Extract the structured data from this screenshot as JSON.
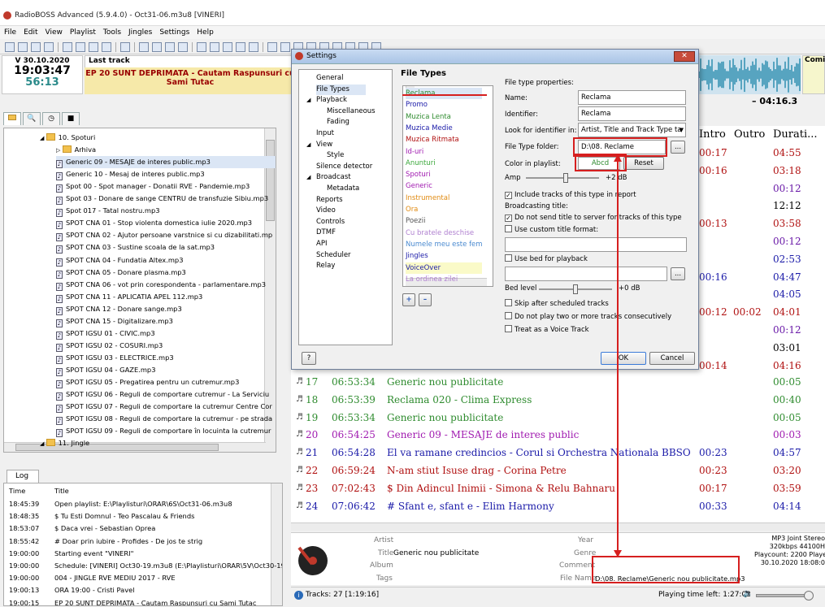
{
  "window": {
    "title": "RadioBOSS Advanced (5.9.4.0) - Oct31-06.m3u8 [VINERI]"
  },
  "menu": [
    "File",
    "Edit",
    "View",
    "Playlist",
    "Tools",
    "Jingles",
    "Settings",
    "Help"
  ],
  "header": {
    "date": "V 30.10.2020",
    "time": "19:03:47",
    "seconds": "56:13",
    "last_track_label": "Last track",
    "now_playing_line1": "EP 20 SUNT DEPRIMATA - Cautam Raspunsuri cu",
    "now_playing_line2": "Sami Tutac",
    "remaining": "– 04:16.3",
    "coming_label": "Comin"
  },
  "left_tabs": [
    "folder",
    "search",
    "clock",
    "db"
  ],
  "tree": [
    {
      "indent": 0,
      "type": "folder",
      "label": "10. Spoturi"
    },
    {
      "indent": 1,
      "type": "folder",
      "label": "Arhiva"
    },
    {
      "indent": 1,
      "type": "file",
      "label": "Generic 09 - MESAJE de interes public.mp3"
    },
    {
      "indent": 1,
      "type": "file",
      "label": "Generic 10 - Mesaj de interes public.mp3"
    },
    {
      "indent": 1,
      "type": "file",
      "label": "Spot 00 - Spot manager - Donatii RVE - Pandemie.mp3"
    },
    {
      "indent": 1,
      "type": "file",
      "label": "Spot 03 - Donare de sange CENTRU de transfuzie Sibiu.mp3"
    },
    {
      "indent": 1,
      "type": "file",
      "label": "Spot 017 - Tatal nostru.mp3"
    },
    {
      "indent": 1,
      "type": "file",
      "label": "SPOT CNA 01 - Stop violenta domestica iulie 2020.mp3"
    },
    {
      "indent": 1,
      "type": "file",
      "label": "SPOT CNA 02 - Ajutor persoane varstnice si cu dizabilitati.mp"
    },
    {
      "indent": 1,
      "type": "file",
      "label": "SPOT CNA 03 - Sustine scoala de la sat.mp3"
    },
    {
      "indent": 1,
      "type": "file",
      "label": "SPOT CNA 04 - Fundatia Altex.mp3"
    },
    {
      "indent": 1,
      "type": "file",
      "label": "SPOT CNA 05 - Donare plasma.mp3"
    },
    {
      "indent": 1,
      "type": "file",
      "label": "SPOT CNA 06 - vot prin corespondenta - parlamentare.mp3"
    },
    {
      "indent": 1,
      "type": "file",
      "label": "SPOT CNA 11 - APLICATIA APEL 112.mp3"
    },
    {
      "indent": 1,
      "type": "file",
      "label": "SPOT CNA 12 - Donare sange.mp3"
    },
    {
      "indent": 1,
      "type": "file",
      "label": "SPOT CNA 15 - Digitalizare.mp3"
    },
    {
      "indent": 1,
      "type": "file",
      "label": "SPOT IGSU 01 - CIVIC.mp3"
    },
    {
      "indent": 1,
      "type": "file",
      "label": "SPOT IGSU 02 - COSURI.mp3"
    },
    {
      "indent": 1,
      "type": "file",
      "label": "SPOT IGSU 03 - ELECTRICE.mp3"
    },
    {
      "indent": 1,
      "type": "file",
      "label": "SPOT IGSU 04 - GAZE.mp3"
    },
    {
      "indent": 1,
      "type": "file",
      "label": "SPOT IGSU 05 - Pregatirea pentru un cutremur.mp3"
    },
    {
      "indent": 1,
      "type": "file",
      "label": "SPOT IGSU 06 - Reguli de comportare cutremur - La Serviciu"
    },
    {
      "indent": 1,
      "type": "file",
      "label": "SPOT IGSU 07 - Reguli de comportare la cutremur Centre Cor"
    },
    {
      "indent": 1,
      "type": "file",
      "label": "SPOT IGSU 08 - Reguli de comportare la cutremur - pe strada"
    },
    {
      "indent": 1,
      "type": "file",
      "label": "SPOT IGSU 09 - Reguli de comportare în locuinta la cutremur"
    },
    {
      "indent": 0,
      "type": "folder",
      "label": "11. Jingle"
    }
  ],
  "log": {
    "title": "Log",
    "columns": [
      "Time",
      "Title"
    ],
    "rows": [
      [
        "18:45:39",
        "Open playlist: E:\\Playlisturi\\ORAR\\6S\\Oct31-06.m3u8"
      ],
      [
        "18:48:35",
        "$ Tu Esti Domnul - Teo Pascalau & Friends"
      ],
      [
        "18:53:07",
        "$ Daca vrei - Sebastian Oprea"
      ],
      [
        "18:55:42",
        "# Doar prin iubire - Profides - De jos te strig"
      ],
      [
        "19:00:00",
        "Starting event \"VINERI\""
      ],
      [
        "19:00:00",
        "Schedule: [VINERI] Oct30-19.m3u8 (E:\\Playlisturi\\ORAR\\5V\\Oct30-19"
      ],
      [
        "19:00:00",
        "004 - JINGLE RVE MEDIU 2017 - RVE"
      ],
      [
        "19:00:13",
        "ORA 19:00 - Cristi Pavel"
      ],
      [
        "19:00:15",
        "EP 20 SUNT DEPRIMATA - Cautam Raspunsuri cu Sami Tutac"
      ]
    ]
  },
  "playlist": {
    "headers": [
      "Intro",
      "Outro",
      "Durati..."
    ],
    "upper_rows": [
      {
        "intro": "00:17",
        "outro": "",
        "dur": "04:55",
        "color": "#b01010"
      },
      {
        "intro": "00:16",
        "outro": "",
        "dur": "03:18",
        "color": "#b01010"
      },
      {
        "intro": "",
        "outro": "",
        "dur": "00:12",
        "color": "#6a1aa8"
      },
      {
        "intro": "",
        "outro": "",
        "dur": "12:12",
        "color": "#000000"
      },
      {
        "intro": "00:13",
        "outro": "",
        "dur": "03:58",
        "color": "#b01010"
      },
      {
        "intro": "",
        "outro": "",
        "dur": "00:12",
        "color": "#6a1aa8"
      },
      {
        "intro": "",
        "outro": "",
        "dur": "02:53",
        "color": "#1a1aa8"
      },
      {
        "intro": "00:16",
        "outro": "",
        "dur": "04:47",
        "color": "#1a1aa8"
      },
      {
        "intro": "",
        "outro": "",
        "dur": "04:05",
        "color": "#1a1aa8"
      },
      {
        "intro": "00:12",
        "outro": "00:02",
        "dur": "04:01",
        "color": "#b01010"
      },
      {
        "intro": "",
        "outro": "",
        "dur": "00:12",
        "color": "#6a1aa8"
      },
      {
        "intro": "",
        "outro": "",
        "dur": "03:01",
        "color": "#000000"
      },
      {
        "intro": "00:14",
        "outro": "",
        "dur": "04:16",
        "color": "#b01010"
      }
    ],
    "rows": [
      {
        "num": "17",
        "time": "06:53:34",
        "title": "Generic nou publicitate",
        "intro": "",
        "outro": "",
        "dur": "00:05",
        "color": "#2e8b2e"
      },
      {
        "num": "18",
        "time": "06:53:39",
        "title": "Reclama 020 - Clima Express",
        "intro": "",
        "outro": "",
        "dur": "00:40",
        "color": "#2e8b2e"
      },
      {
        "num": "19",
        "time": "06:53:34",
        "title": "Generic nou publicitate",
        "intro": "",
        "outro": "",
        "dur": "00:05",
        "color": "#2e8b2e"
      },
      {
        "num": "20",
        "time": "06:54:25",
        "title": "Generic 09 - MESAJE de interes public",
        "intro": "",
        "outro": "",
        "dur": "00:03",
        "color": "#a01ab0"
      },
      {
        "num": "21",
        "time": "06:54:28",
        "title": "El va ramane credincios - Corul si Orchestra Nationala BBSO",
        "intro": "00:23",
        "outro": "",
        "dur": "04:57",
        "color": "#1a1aa8"
      },
      {
        "num": "22",
        "time": "06:59:24",
        "title": "N-am stiut Isuse drag - Corina Petre",
        "intro": "00:23",
        "outro": "",
        "dur": "03:20",
        "color": "#b01010"
      },
      {
        "num": "23",
        "time": "07:02:43",
        "title": "$ Din Adincul Inimii - Simona & Relu Bahnaru",
        "intro": "00:17",
        "outro": "",
        "dur": "03:59",
        "color": "#b01010"
      },
      {
        "num": "24",
        "time": "07:06:42",
        "title": "# Sfant e, sfant e - Elim Harmony",
        "intro": "00:33",
        "outro": "",
        "dur": "04:14",
        "color": "#1a1aa8"
      }
    ]
  },
  "info": {
    "artist_label": "Artist",
    "title_label": "Title",
    "album_label": "Album",
    "tags_label": "Tags",
    "title_value": "Generic nou publicitate",
    "year_label": "Year",
    "genre_label": "Genre",
    "comment_label": "Comment",
    "filename_label": "File Name",
    "filename_value": "D:\\08. Reclame\\Generic nou publicitate.mp3",
    "format": "MP3 Joint Stereo",
    "bitrate": "320kbps 44100H",
    "playcount": "Playcount: 2200  Played",
    "date": "30.10.2020 18:08:0"
  },
  "status": {
    "tracks": "Tracks: 27 [1:19:16]",
    "playing_left": "Playing time left: 1:27:02"
  },
  "dialog": {
    "title": "Settings",
    "nav": [
      {
        "indent": 0,
        "label": "General"
      },
      {
        "indent": 0,
        "label": "File Types",
        "selected": true
      },
      {
        "indent": 0,
        "label": "Playback",
        "arrow": true
      },
      {
        "indent": 2,
        "label": "Miscellaneous"
      },
      {
        "indent": 2,
        "label": "Fading"
      },
      {
        "indent": 0,
        "label": "Input"
      },
      {
        "indent": 0,
        "label": "View",
        "arrow": true
      },
      {
        "indent": 2,
        "label": "Style"
      },
      {
        "indent": 0,
        "label": "Silence detector"
      },
      {
        "indent": 0,
        "label": "Broadcast",
        "arrow": true
      },
      {
        "indent": 2,
        "label": "Metadata"
      },
      {
        "indent": 0,
        "label": "Reports"
      },
      {
        "indent": 0,
        "label": "Video"
      },
      {
        "indent": 0,
        "label": "Controls"
      },
      {
        "indent": 0,
        "label": "DTMF"
      },
      {
        "indent": 0,
        "label": "API"
      },
      {
        "indent": 0,
        "label": "Scheduler"
      },
      {
        "indent": 0,
        "label": "Relay"
      }
    ],
    "section_title": "File Types",
    "file_types": [
      {
        "label": "Reclama",
        "color": "#2e8b2e"
      },
      {
        "label": "Promo",
        "color": "#1a1aa8"
      },
      {
        "label": "Muzica Lenta",
        "color": "#2e8b2e"
      },
      {
        "label": "Muzica Medie",
        "color": "#1a1aa8"
      },
      {
        "label": "Muzica Ritmata",
        "color": "#b01010"
      },
      {
        "label": "Id-uri",
        "color": "#a01ab0"
      },
      {
        "label": "Anunturi",
        "color": "#3aa83a"
      },
      {
        "label": "Spoturi",
        "color": "#a01ab0"
      },
      {
        "label": "Generic",
        "color": "#a01ab0"
      },
      {
        "label": "Instrumental",
        "color": "#e08a10"
      },
      {
        "label": "Ora",
        "color": "#e08a10"
      },
      {
        "label": "Poezii",
        "color": "#555555"
      },
      {
        "label": "Cu bratele deschise",
        "color": "#b080d0"
      },
      {
        "label": "Numele meu este feme",
        "color": "#4a8ad0"
      },
      {
        "label": "Jingles",
        "color": "#1a1aa8"
      },
      {
        "label": "VoiceOver",
        "color": "#1a1aa8"
      },
      {
        "label": "La ordinea zilei",
        "color": "#b080d0"
      }
    ],
    "props_label": "File type properties:",
    "name_label": "Name:",
    "name_value": "Reclama",
    "identifier_label": "Identifier:",
    "identifier_value": "Reclama",
    "look_label": "Look for identifier in:",
    "look_value": "Artist, Title and Track Type ta",
    "folder_label": "File Type folder:",
    "folder_value": "D:\\08. Reclame",
    "color_label": "Color in playlist:",
    "color_sample": "Abcd",
    "reset_label": "Reset",
    "amp_label": "Amp",
    "amp_value": "+2 dB",
    "include_label": "Include tracks of this type in report",
    "broadcasting_label": "Broadcasting title:",
    "donotsend_label": "Do not send title to server for tracks of this type",
    "custom_title_label": "Use custom title format:",
    "use_bed_label": "Use bed for playback",
    "bedlevel_label": "Bed level",
    "bedlevel_value": "+0 dB",
    "skip_label": "Skip after scheduled tracks",
    "noconsec_label": "Do not play two or more tracks consecutively",
    "voicetrack_label": "Treat as a Voice Track",
    "ok_label": "OK",
    "cancel_label": "Cancel",
    "help_label": "?",
    "add_label": "+",
    "remove_label": "–",
    "browse_label": "...",
    "checked": {
      "include": true,
      "donotsend": true,
      "custom": false,
      "bed": false,
      "skip": false,
      "noconsec": false,
      "voice": false
    }
  }
}
